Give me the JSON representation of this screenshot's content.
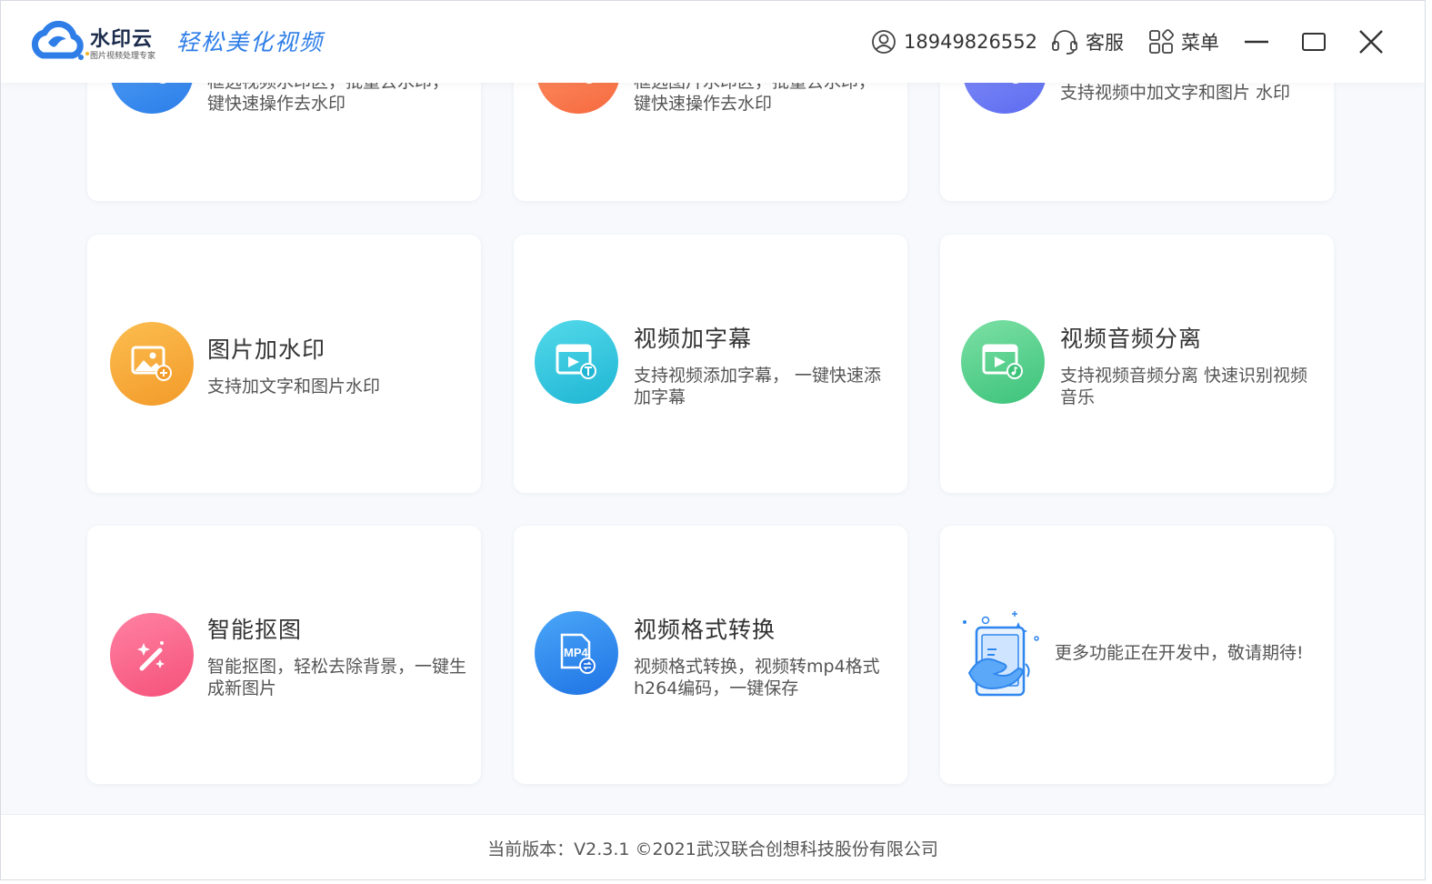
{
  "header": {
    "brand_name": "水印云",
    "brand_sub": "图片视频处理专家",
    "slogan": "轻松美化视频",
    "phone": "18949826552",
    "service_label": "客服",
    "menu_label": "菜单"
  },
  "cards_top": [
    {
      "desc": "框选视频水印区，批量去水印，一键快速操作去水印",
      "color": "#3b8df0"
    },
    {
      "desc": "框选图片水印区，批量去水印，一键快速操作去水印",
      "color": "#fb7e57"
    },
    {
      "desc": "支持视频中加文字和图片 水印",
      "color": "#6a7cf4"
    }
  ],
  "cards": [
    {
      "title": "图片加水印",
      "desc": "支持加文字和图片水印",
      "icon": "image-add-icon",
      "color": "#f7a93a"
    },
    {
      "title": "视频加字幕",
      "desc": "支持视频添加字幕，  一键快速添加字幕",
      "icon": "video-subtitle-icon",
      "color": "#2fc6e0"
    },
    {
      "title": "视频音频分离",
      "desc": "支持视频音频分离 快速识别视频音乐",
      "icon": "video-audio-icon",
      "color": "#4fcf8a"
    },
    {
      "title": "智能抠图",
      "desc": "智能抠图，轻松去除背景，一键生成新图片",
      "icon": "magic-wand-icon",
      "color": "#f8607e"
    },
    {
      "title": "视频格式转换",
      "desc": "视频格式转换，视频转mp4格式h264编码，一键保存",
      "icon": "mp4-convert-icon",
      "color": "#2f86ee"
    }
  ],
  "more": {
    "desc": "更多功能正在开发中，敬请期待!"
  },
  "icons": {
    "mp4": "MP4"
  },
  "footer": {
    "text": "当前版本：V2.3.1 ©2021武汉联合创想科技股份有限公司"
  }
}
